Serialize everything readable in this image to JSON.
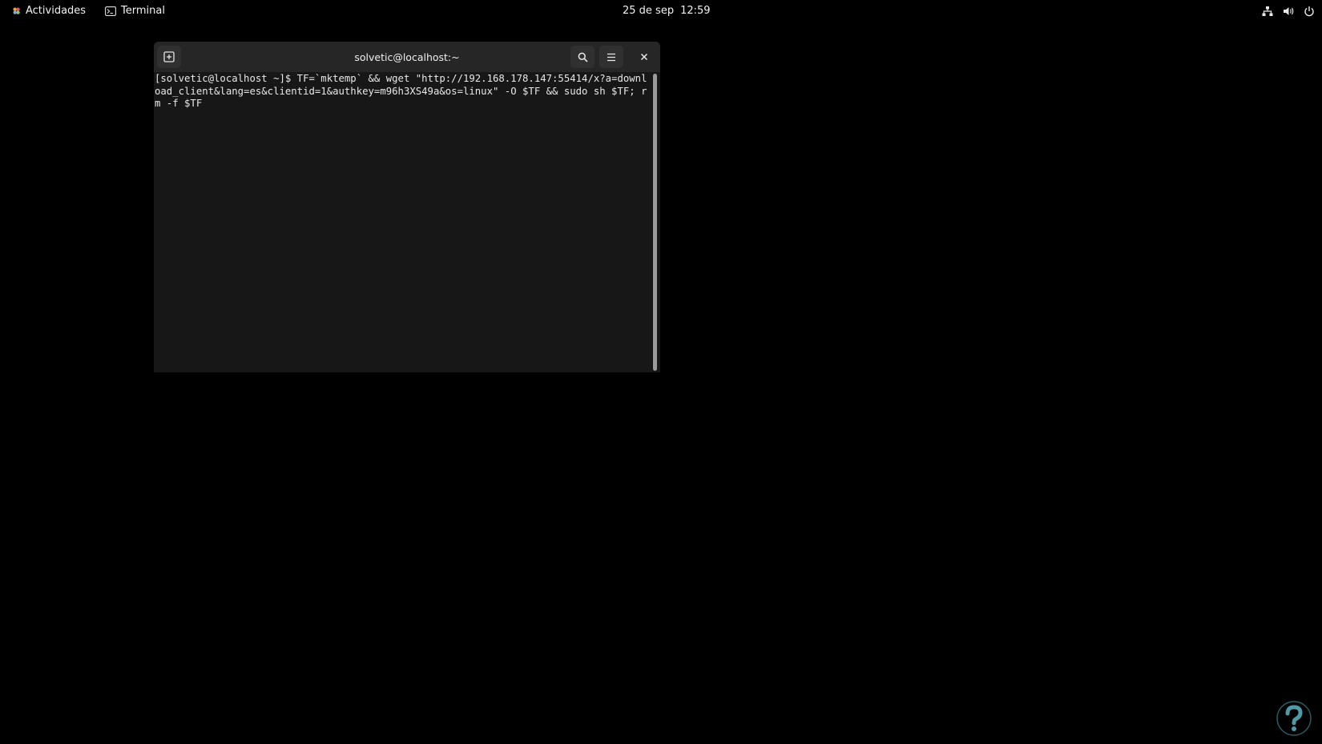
{
  "topbar": {
    "activities_label": "Actividades",
    "app_name": "Terminal",
    "date": "25 de sep",
    "time": "12:59",
    "tray_icons": [
      "network-icon",
      "volume-icon",
      "power-icon"
    ]
  },
  "terminal": {
    "title": "solvetic@localhost:~",
    "content": "[solvetic@localhost ~]$ TF=`mktemp` && wget \"http://192.168.178.147:55414/x?a=download_client&lang=es&clientid=1&authkey=m96h3XS49a&os=linux\" -O $TF && sudo sh $TF; rm -f $TF",
    "buttons": {
      "new_tab_icon": "new-tab-icon",
      "search_icon": "search-icon",
      "menu_icon": "hamburger-menu-icon",
      "close_icon": "close-icon"
    }
  },
  "colors": {
    "desktop_bg": "#000000",
    "terminal_bg": "#171717",
    "titlebar_bg": "#262626",
    "text": "#e8e8e8"
  }
}
